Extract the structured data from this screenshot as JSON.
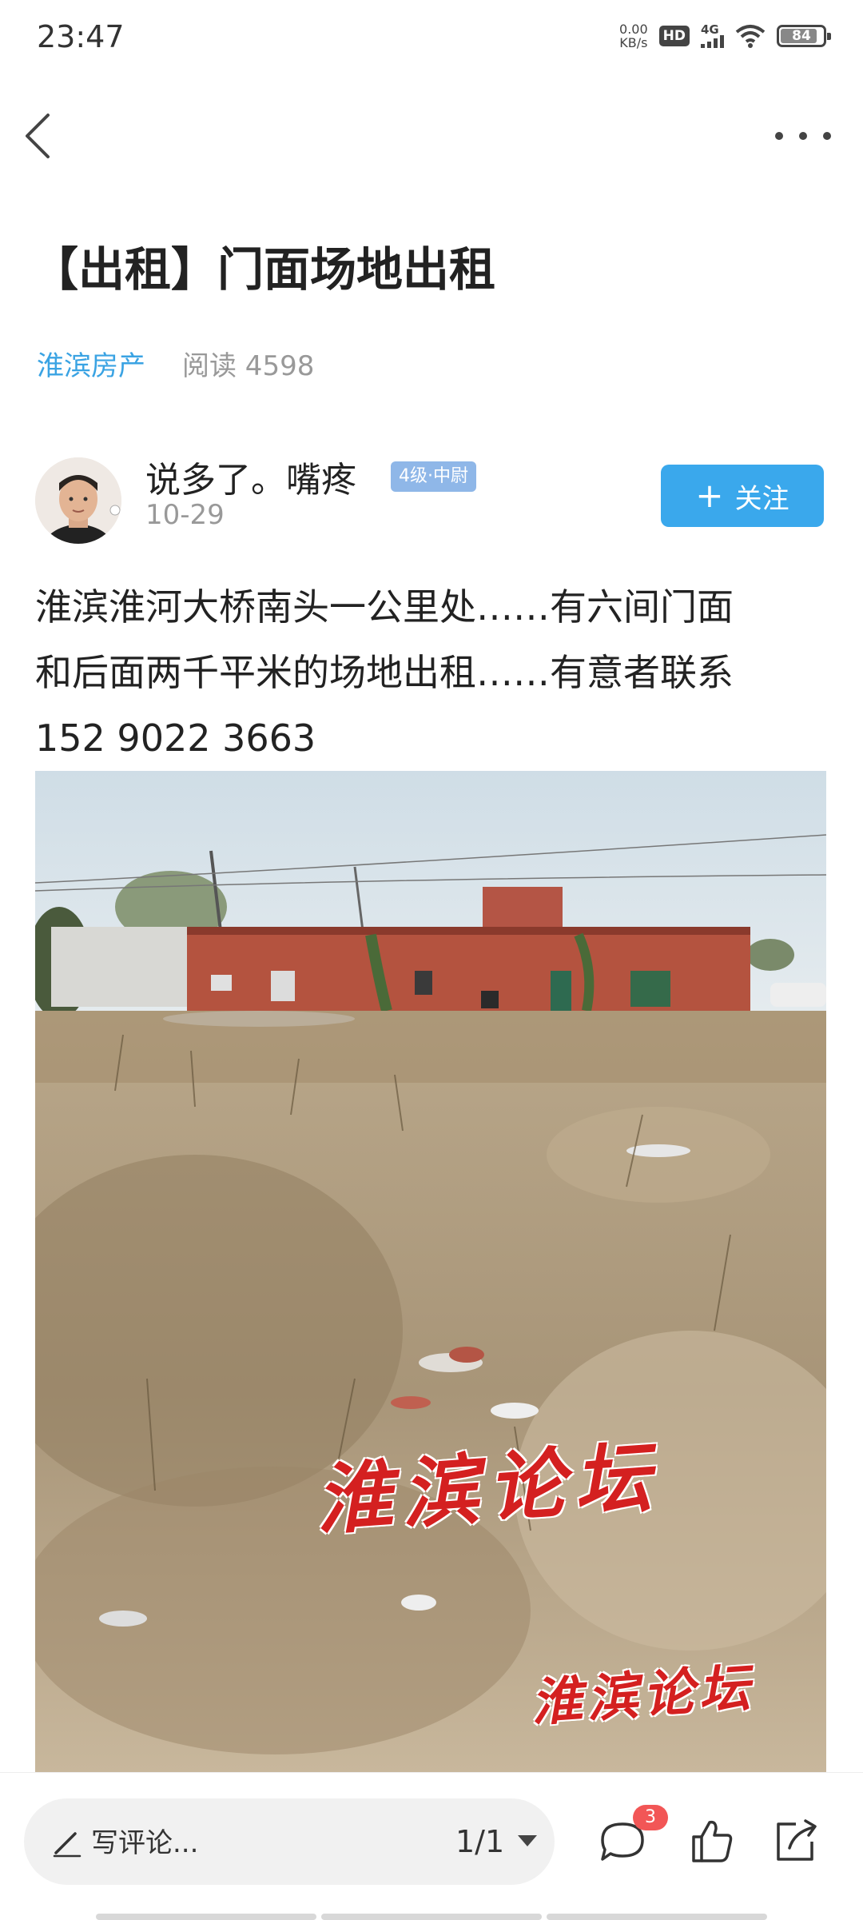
{
  "status_bar": {
    "time": "23:47",
    "net_speed_value": "0.00",
    "net_speed_unit": "KB/s",
    "hd": "HD",
    "signal": "4G",
    "battery": "84"
  },
  "nav": {
    "back_icon": "chevron-left-icon",
    "more_icon": "more-dots-icon"
  },
  "post": {
    "title": "【出租】门面场地出租",
    "category": "淮滨房产",
    "reads": "阅读 4598",
    "author": {
      "name": "说多了。嘴疼",
      "level": "4级·中尉",
      "date": "10-29"
    },
    "follow_label": "关注",
    "content_line1": "淮滨淮河大桥南头一公里处……有六间门面",
    "content_line2": "和后面两千平米的场地出租……有意者联系",
    "content_line3": "152 9022 3663",
    "photo_watermark_1": "淮滨论坛",
    "photo_watermark_2": "淮滨论坛"
  },
  "bottom_bar": {
    "comment_placeholder": "写评论...",
    "page_indicator": "1/1",
    "comment_count": "3",
    "icons": [
      "pen-icon",
      "dropdown-caret-icon",
      "comment-icon",
      "like-icon",
      "share-icon"
    ]
  },
  "colors": {
    "accent": "#3aa8ec",
    "category": "#3aa3e3",
    "badge": "#f25656",
    "level_badge": "#8fb7e8"
  }
}
